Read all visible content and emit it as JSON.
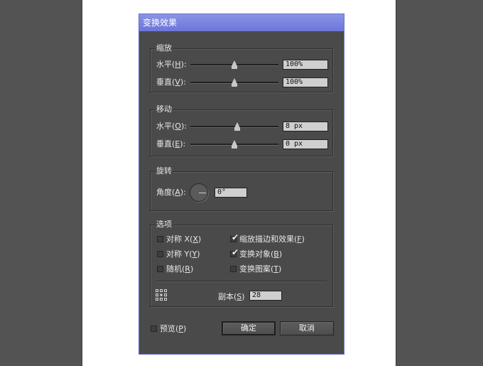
{
  "dialog": {
    "title": "变换效果",
    "scale": {
      "title": "缩放",
      "horizontal_label": "水平(",
      "horizontal_key": "H",
      "label_end": "):",
      "horizontal_value": "100%",
      "horizontal_slider_pct": 50,
      "vertical_label": "垂直(",
      "vertical_key": "V",
      "vertical_value": "100%",
      "vertical_slider_pct": 50
    },
    "move": {
      "title": "移动",
      "horizontal_label": "水平(",
      "horizontal_key": "O",
      "label_end": "):",
      "horizontal_value": "8 px",
      "horizontal_slider_pct": 53,
      "vertical_label": "垂直(",
      "vertical_key": "E",
      "vertical_value": "0 px",
      "vertical_slider_pct": 50
    },
    "rotate": {
      "title": "旋转",
      "angle_label": "角度(",
      "angle_key": "A",
      "label_end": "):",
      "angle_value": "0°"
    },
    "options": {
      "title": "选项",
      "reflect_x_label": "对称 X(",
      "reflect_x_key": "X",
      "reflect_x_checked": false,
      "reflect_y_label": "对称 Y(",
      "reflect_y_key": "Y",
      "reflect_y_checked": false,
      "random_label": "随机(",
      "random_key": "R",
      "random_checked": false,
      "scale_strokes_label": "缩放描边和效果(",
      "scale_strokes_key": "F",
      "scale_strokes_checked": true,
      "transform_objects_label": "变换对象(",
      "transform_objects_key": "B",
      "transform_objects_checked": true,
      "transform_patterns_label": "变换图案(",
      "transform_patterns_key": "T",
      "transform_patterns_checked": false,
      "paren_close": ")",
      "copies_label": "副本(",
      "copies_key": "S",
      "copies_end": ")",
      "copies_value": "28"
    },
    "preview": {
      "label": "预览(",
      "key": "P",
      "end": ")",
      "checked": false
    },
    "ok_label": "确定",
    "cancel_label": "取消"
  },
  "colors": {
    "workspace": "#535353",
    "dialog_bg": "#4a4a4a",
    "titlebar": "#7a84df",
    "field_bg": "#cfcfcf"
  }
}
